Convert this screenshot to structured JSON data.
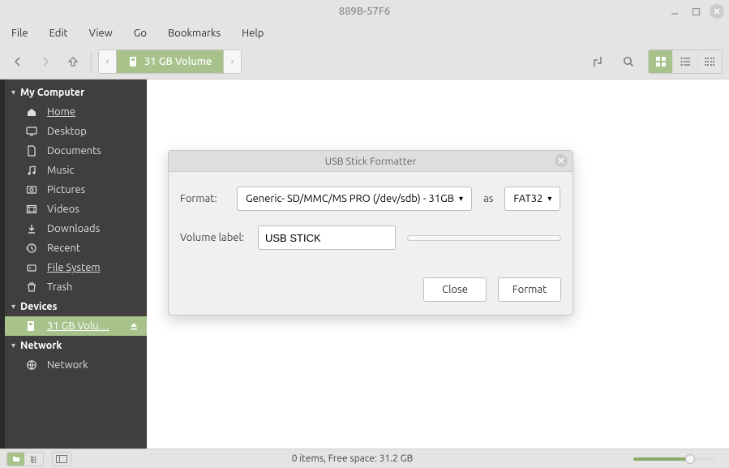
{
  "window": {
    "title": "889B-57F6"
  },
  "menu": {
    "file": "File",
    "edit": "Edit",
    "view": "View",
    "go": "Go",
    "bookmarks": "Bookmarks",
    "help": "Help"
  },
  "pathbar": {
    "location_label": "31 GB Volume"
  },
  "sidebar": {
    "sections": {
      "computer": "My Computer",
      "devices": "Devices",
      "network": "Network"
    },
    "computer_items": [
      {
        "label": "Home",
        "underline": true
      },
      {
        "label": "Desktop"
      },
      {
        "label": "Documents"
      },
      {
        "label": "Music"
      },
      {
        "label": "Pictures"
      },
      {
        "label": "Videos"
      },
      {
        "label": "Downloads"
      },
      {
        "label": "Recent"
      },
      {
        "label": "File System",
        "underline": true
      },
      {
        "label": "Trash"
      }
    ],
    "devices_items": [
      {
        "label": "31 GB Volu…",
        "underline": true,
        "active": true,
        "ejectable": true
      }
    ],
    "network_items": [
      {
        "label": "Network"
      }
    ]
  },
  "statusbar": {
    "text": "0 items, Free space: 31.2 GB"
  },
  "dialog": {
    "title": "USB Stick Formatter",
    "format_label": "Format:",
    "device": "Generic- SD/MMC/MS PRO (/dev/sdb) - 31GB",
    "as_label": "as",
    "filesystem": "FAT32",
    "volume_label_label": "Volume label:",
    "volume_label_value": "USB STICK",
    "close_btn": "Close",
    "format_btn": "Format"
  }
}
